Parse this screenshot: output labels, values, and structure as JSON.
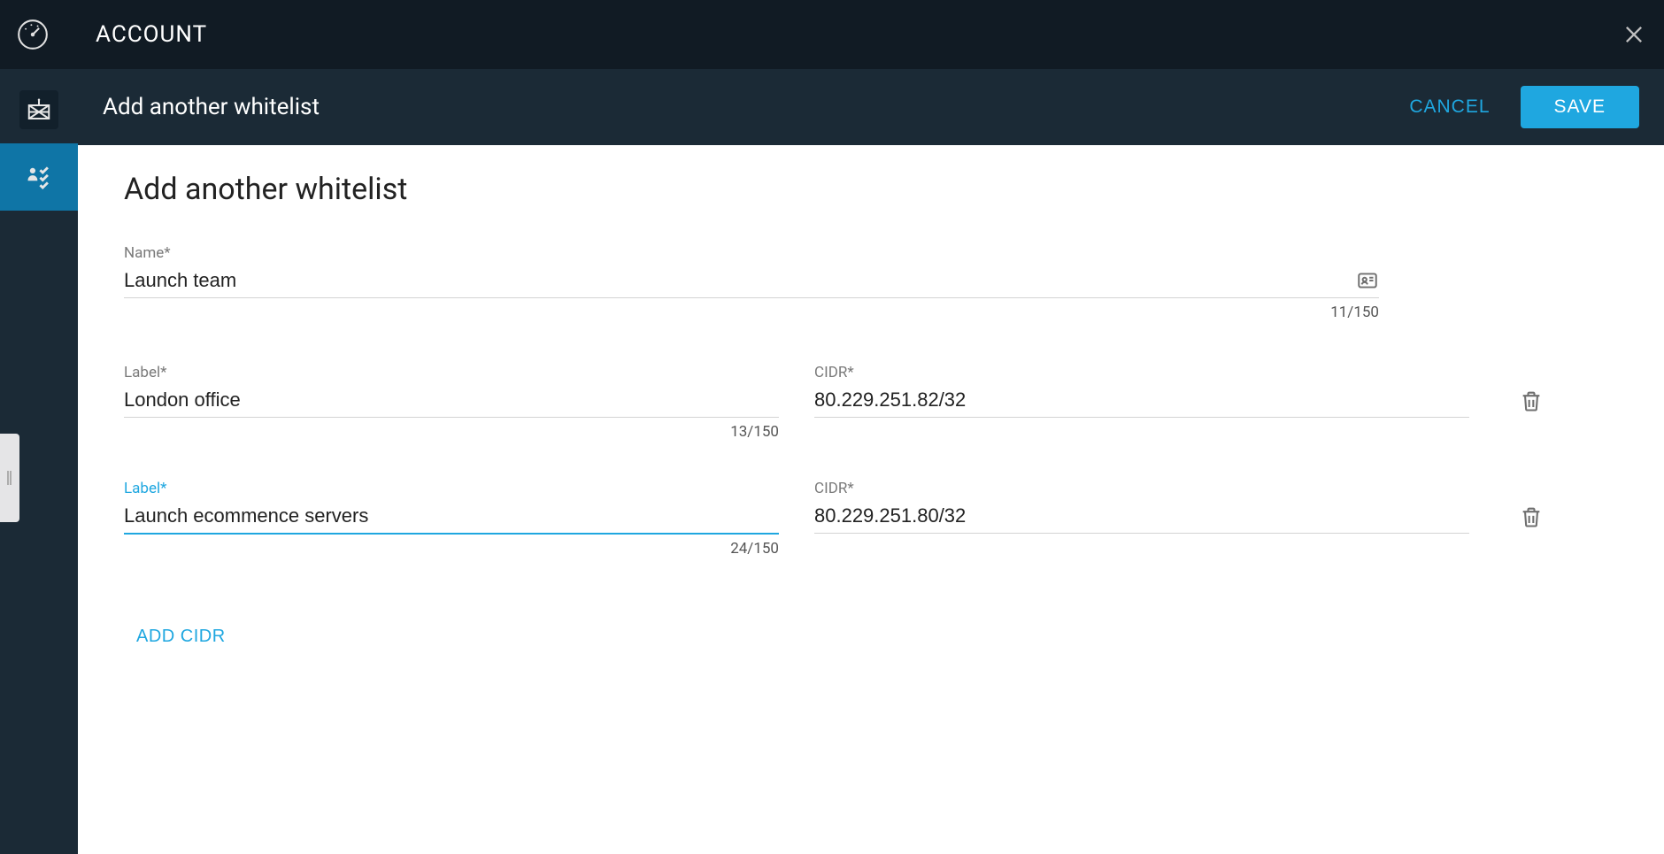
{
  "topbar": {
    "title": "ACCOUNT"
  },
  "sidebar": {
    "items": [
      {
        "name": "nav-fabric"
      },
      {
        "name": "nav-whitelists"
      }
    ]
  },
  "subheader": {
    "title": "Add another whitelist",
    "cancel_label": "CANCEL",
    "save_label": "SAVE"
  },
  "form": {
    "heading": "Add another whitelist",
    "name_label": "Name*",
    "name_value": "Launch team",
    "name_counter": "11/150",
    "rows": [
      {
        "label_label": "Label*",
        "label_value": "London office",
        "label_counter": "13/150",
        "cidr_label": "CIDR*",
        "cidr_value": "80.229.251.82/32",
        "focused": false
      },
      {
        "label_label": "Label*",
        "label_value": "Launch ecommence servers",
        "label_counter": "24/150",
        "cidr_label": "CIDR*",
        "cidr_value": "80.229.251.80/32",
        "focused": true
      }
    ],
    "add_cidr_label": "ADD CIDR"
  }
}
